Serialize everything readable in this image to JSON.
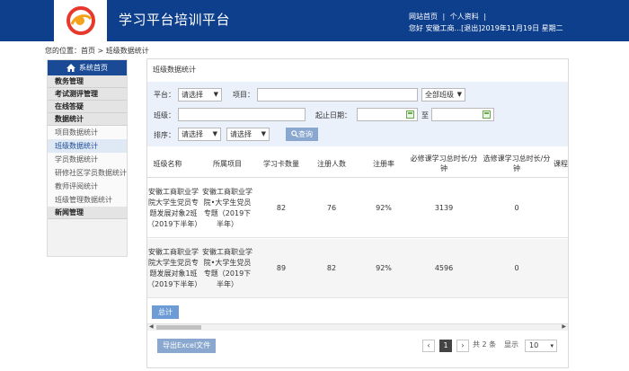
{
  "header": {
    "title": "学习平台培训平台",
    "links": [
      "网站首页",
      "|",
      "个人资料",
      "|"
    ],
    "greeting": "您好  安徽工商...[退出]",
    "date": "2019年11月19日 星期二"
  },
  "breadcrumb": "您的位置：首页 > 班级数据统计",
  "sidebar": {
    "home": "系统首页",
    "groups": [
      {
        "label": "教务管理",
        "items": []
      },
      {
        "label": "考试测评管理",
        "items": []
      },
      {
        "label": "在线答疑",
        "items": []
      },
      {
        "label": "数据统计",
        "items": [
          "项目数据统计",
          "班级数据统计",
          "学员数据统计",
          "研修社区学员数据统计",
          "教师评阅统计",
          "班级管理数据统计"
        ]
      },
      {
        "label": "新闻管理",
        "items": []
      }
    ],
    "active": "班级数据统计"
  },
  "panel": {
    "title": "班级数据统计",
    "filters": {
      "platform_label": "平台：",
      "platform_value": "请选择",
      "project_label": "项目：",
      "project_value": "",
      "project_select": "全部班级",
      "class_label": "班级：",
      "class_value": "",
      "date_label": "起止日期：",
      "date_sep": "至",
      "sort_label": "排序：",
      "sort_value1": "请选择",
      "sort_value2": "请选择",
      "query_btn": "查询"
    },
    "table": {
      "columns": [
        "班级名称",
        "所属项目",
        "学习卡数量",
        "注册人数",
        "注册率",
        "必修课学习总时长/分钟",
        "选修课学习总时长/分钟",
        "课程"
      ],
      "rows": [
        [
          "安徽工商职业学院大学生党员专题发展对象2班（2019下半年）",
          "安徽工商职业学院•大学生党员专题（2019下半年）",
          "82",
          "76",
          "92%",
          "3139",
          "0"
        ],
        [
          "安徽工商职业学院大学生党员专题发展对象1班（2019下半年）",
          "安徽工商职业学院•大学生党员专题（2019下半年）",
          "89",
          "82",
          "92%",
          "4596",
          "0"
        ]
      ]
    },
    "total_btn": "总计",
    "export_btn": "导出Excel文件",
    "pager": {
      "current": "1",
      "total_text": "共 2 条",
      "show_label": "显示",
      "page_size": "10"
    }
  }
}
